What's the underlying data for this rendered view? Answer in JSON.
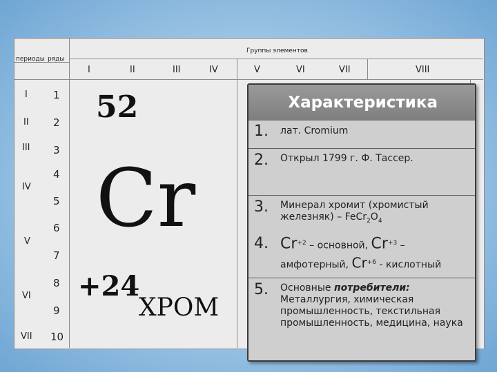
{
  "header": {
    "periods_label": "периоды",
    "rows_label": "ряды",
    "groups_label": "Группы элементов",
    "groups": [
      "I",
      "II",
      "III",
      "IV",
      "V",
      "VI",
      "VII",
      "VIII"
    ]
  },
  "periods": [
    "I",
    "II",
    "III",
    "IV",
    "V",
    "VI",
    "VII"
  ],
  "rows": [
    "1",
    "2",
    "3",
    "4",
    "5",
    "6",
    "7",
    "8",
    "9",
    "10"
  ],
  "element": {
    "atomic_number": "52",
    "symbol": "Cr",
    "charge": "+24",
    "name": "ХРОМ"
  },
  "card": {
    "title": "Характеристика",
    "items": [
      {
        "num": "1.",
        "text": "лат. Cromium"
      },
      {
        "num": "2.",
        "text": "Открыл 1799 г. Ф. Тассер."
      },
      {
        "num": "3.",
        "text_a": "Минерал хромит (хромистый железняк) – FeCr",
        "sub1": "2",
        "text_b": "O",
        "sub2": "4"
      },
      {
        "num": "4.",
        "cr": "Cr",
        "ox1": "+2",
        "t1": " – основной, ",
        "ox2": "+3",
        "t2": " – амфотерный, ",
        "ox3": "+6",
        "t3": " - кислотный"
      },
      {
        "num": "5.",
        "text_a": "Основные ",
        "text_em": "потребители:",
        "text_b": " Металлургия, химическая промышленность, текстильная промышленность, медицина, наука"
      }
    ]
  }
}
